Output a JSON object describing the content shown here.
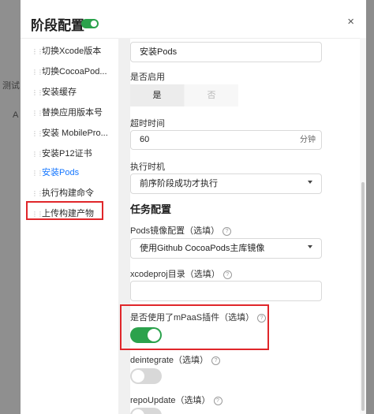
{
  "background": {
    "side_text": "测试",
    "side_mark": "A"
  },
  "dialog": {
    "title": "阶段配置",
    "header_toggle_on": true,
    "close_glyph": "×"
  },
  "sidebar": {
    "items": [
      {
        "label": "切换Xcode版本",
        "active": false
      },
      {
        "label": "切换CocoaPod...",
        "active": false
      },
      {
        "label": "安装缓存",
        "active": false
      },
      {
        "label": "替换应用版本号",
        "active": false
      },
      {
        "label": "安装 MobilePro...",
        "active": false
      },
      {
        "label": "安装P12证书",
        "active": false
      },
      {
        "label": "安装Pods",
        "active": true
      },
      {
        "label": "执行构建命令",
        "active": false
      },
      {
        "label": "上传构建产物",
        "active": false
      }
    ]
  },
  "main": {
    "name_value": "安装Pods",
    "enabled_label": "是否启用",
    "enabled_options": [
      "是",
      "否"
    ],
    "enabled_selected": "是",
    "timeout_label": "超时时间",
    "timeout_value": "60",
    "timeout_unit": "分钟",
    "timing_label": "执行时机",
    "timing_value": "前序阶段成功才执行",
    "task_section": "任务配置",
    "mirror_label": "Pods镜像配置（选填）",
    "mirror_value": "使用Github CocoaPods主库镜像",
    "xcodeproj_label": "xcodeproj目录（选填）",
    "xcodeproj_value": "",
    "mpaas_label": "是否使用了mPaaS插件（选填）",
    "mpaas_on": true,
    "deintegrate_label": "deintegrate（选填）",
    "deintegrate_on": false,
    "repoupdate_label": "repoUpdate（选填）"
  },
  "colors": {
    "accent_green": "#2ba24c",
    "active_blue": "#1677ff",
    "highlight_red": "#e0262a"
  },
  "icons": {
    "help": "question-circle-icon",
    "drag": "drag-handle-icon",
    "select": "caret-down-icon"
  }
}
